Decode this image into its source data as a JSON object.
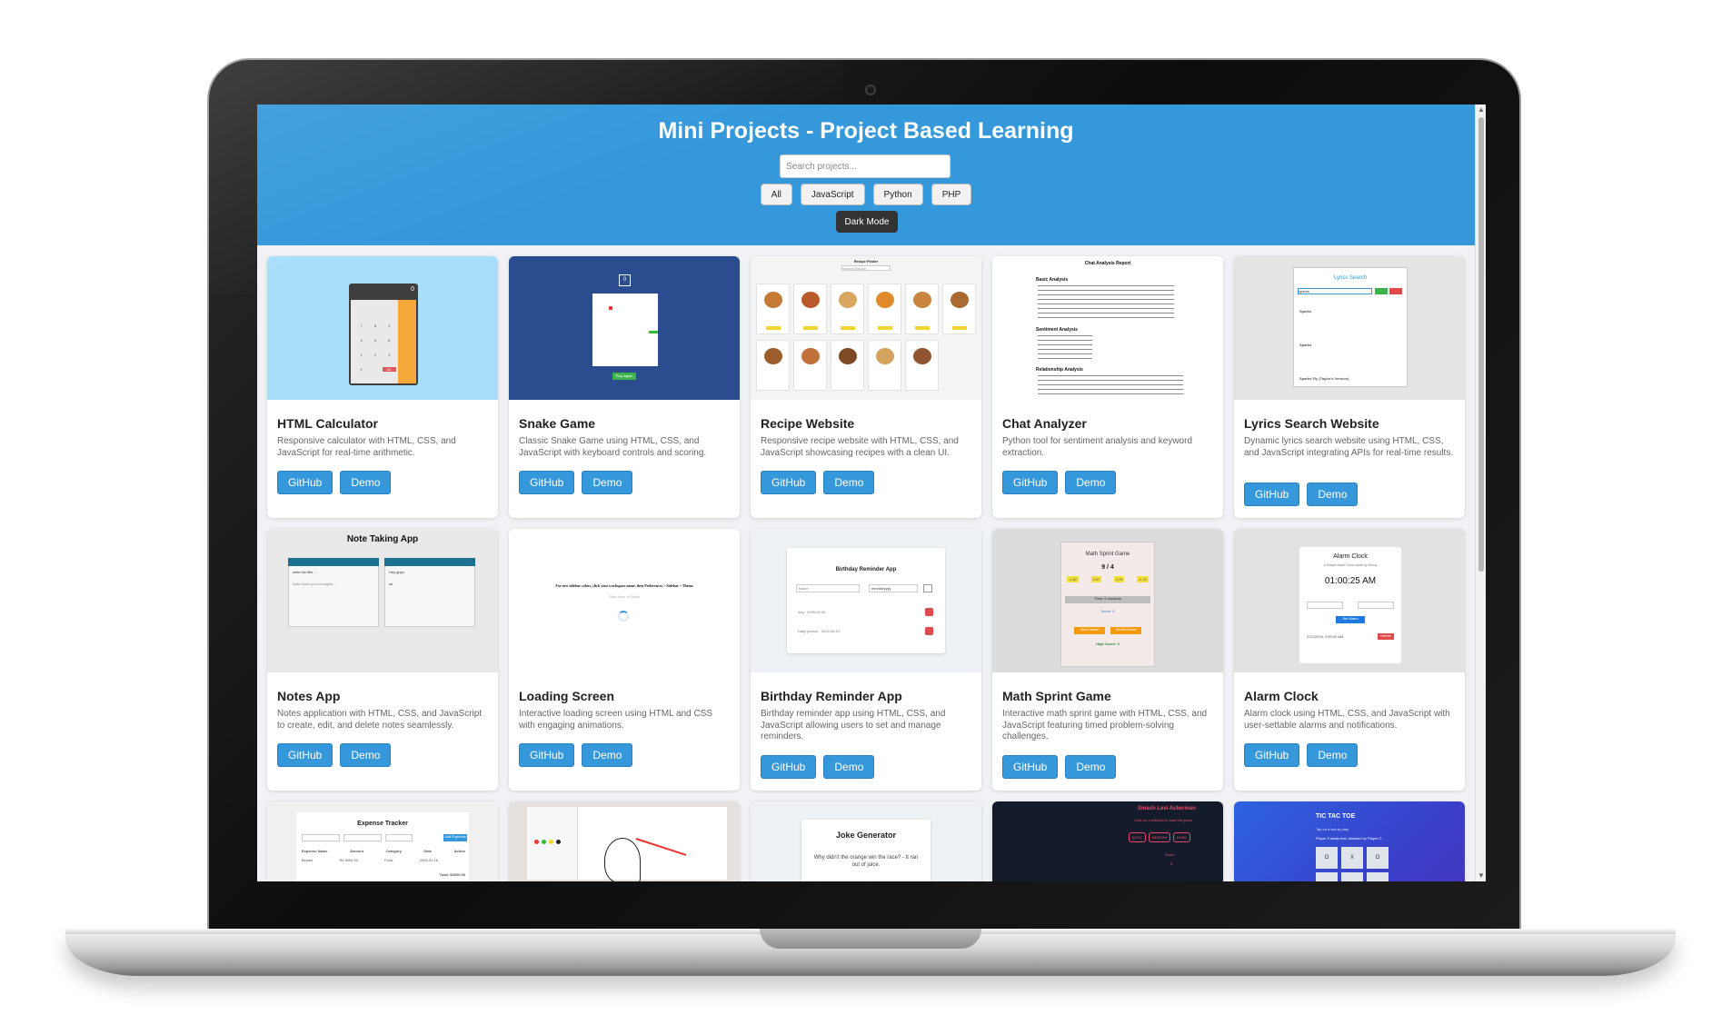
{
  "page": {
    "title": "Mini Projects - Project Based Learning",
    "search_placeholder": "Search projects...",
    "filters": [
      "All",
      "JavaScript",
      "Python",
      "PHP"
    ],
    "dark_mode_label": "Dark Mode"
  },
  "colors": {
    "header_bg": "#3498db",
    "button_bg": "#3498db",
    "dark_button_bg": "#333333",
    "page_bg": "#f0f2f5"
  },
  "buttons": {
    "github": "GitHub",
    "demo": "Demo"
  },
  "projects": [
    {
      "title": "HTML Calculator",
      "description": "Responsive calculator with HTML, CSS, and JavaScript for real-time arithmetic."
    },
    {
      "title": "Snake Game",
      "description": "Classic Snake Game using HTML, CSS, and JavaScript with keyboard controls and scoring."
    },
    {
      "title": "Recipe Website",
      "description": "Responsive recipe website with HTML, CSS, and JavaScript showcasing recipes with a clean UI."
    },
    {
      "title": "Chat Analyzer",
      "description": "Python tool for sentiment analysis and keyword extraction."
    },
    {
      "title": "Lyrics Search Website",
      "description": "Dynamic lyrics search website using HTML, CSS, and JavaScript integrating APIs for real-time results."
    },
    {
      "title": "Notes App",
      "description": "Notes application with HTML, CSS, and JavaScript to create, edit, and delete notes seamlessly."
    },
    {
      "title": "Loading Screen",
      "description": "Interactive loading screen using HTML and CSS with engaging animations."
    },
    {
      "title": "Birthday Reminder App",
      "description": "Birthday reminder app using HTML, CSS, and JavaScript allowing users to set and manage reminders."
    },
    {
      "title": "Math Sprint Game",
      "description": "Interactive math sprint game with HTML, CSS, and JavaScript featuring timed problem-solving challenges."
    },
    {
      "title": "Alarm Clock",
      "description": "Alarm clock using HTML, CSS, and JavaScript with user-settable alarms and notifications."
    }
  ],
  "thumbnails": {
    "calculator": {
      "display": "0",
      "keys": [
        "7",
        "8",
        "9",
        "4",
        "5",
        "6",
        "1",
        "2",
        "3",
        "0",
        "AC"
      ]
    },
    "snake": {
      "score": "0",
      "button": "Play Again"
    },
    "recipe": {
      "heading": "Recipe Finder",
      "search": "Search Recipe"
    },
    "chat": {
      "heading": "Chat Analysis Report",
      "sections": [
        "Basic Analysis",
        "Sentiment Analysis",
        "Relationship Analysis"
      ]
    },
    "lyrics": {
      "heading": "Lyrics Search",
      "query": "sparks",
      "results": [
        "Sparks",
        "Sparks",
        "Sparks Fly (Taylor's Version)"
      ]
    },
    "notes": {
      "heading": "Note Taking App",
      "note1_title": "write the title ...",
      "note1_body": "Note down your thoughts ....",
      "note2_title": "Hey guys",
      "note2_body": "ok"
    },
    "loading": {
      "message": "For new sidebar colors, click your workspace name, then Preferences > Sidebar > Theme",
      "sub": "Slow Hour of Slack"
    },
    "birthday": {
      "heading": "Birthday Reminder App",
      "name_placeholder": "Name",
      "date_placeholder": "mm/dd/yyyy",
      "entries": [
        "hey - 2025-02-03",
        "Daily person - 2016-06-01"
      ]
    },
    "math": {
      "heading": "Math Sprint Game",
      "question": "9 / 4",
      "options": [
        "-1.82",
        "4.07",
        "2.25",
        "-2.22"
      ],
      "time": "Time: 6 seconds",
      "score": "Score: 0",
      "start": "Start Game",
      "reset": "Reset Game",
      "high_score": "High Score: 0"
    },
    "alarm": {
      "heading": "Alarm Clock",
      "subtitle": "A Simple Alarm Clock made by Moxxy",
      "time": "01:00:25 AM",
      "set_label": "Set Alarm",
      "entry": "2/22/2026, 2:00:00 AM",
      "delete": "Delete"
    },
    "expense": {
      "heading": "Expense Tracker",
      "columns": [
        "Expense Name",
        "Amount",
        "Category",
        "Date",
        "Action"
      ],
      "row": [
        "Biryani",
        "Rs 3000.00",
        "Food",
        "2025-02-16"
      ],
      "total": "Total: $3000.00",
      "add": "Add Expense"
    },
    "joke": {
      "heading": "Joke Generator",
      "text": "Why didn't the orange win the race? - It ran out of juice."
    },
    "levi": {
      "heading": "Smash Levi Ackerman",
      "hint": "Click on a difficulty to start the game",
      "levels": [
        "EASY",
        "MEDIUM",
        "HARD"
      ],
      "score_label": "Score",
      "score": "0"
    },
    "tictactoe": {
      "heading": "TIC TAC TOE",
      "sub": "Tap on a box to play",
      "status": "Player X starts first, followed by Player O",
      "cells": [
        "O",
        "X",
        "O"
      ]
    }
  }
}
